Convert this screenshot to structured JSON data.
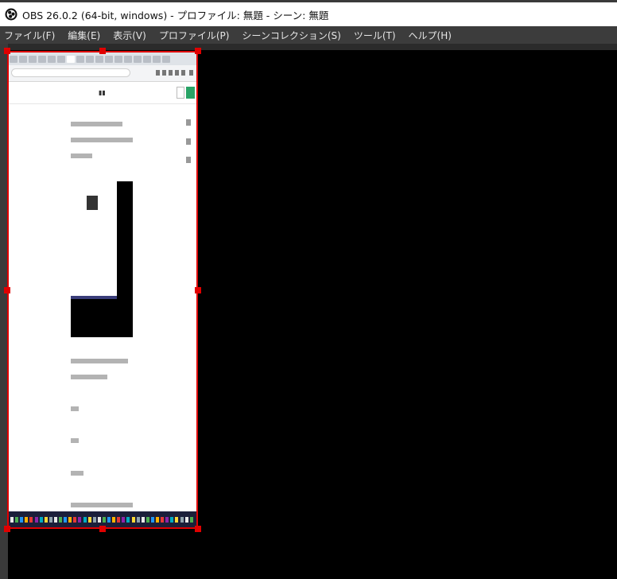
{
  "window": {
    "title": "OBS 26.0.2 (64-bit, windows) - プロファイル: 無題 - シーン: 無題"
  },
  "menu": {
    "items": [
      {
        "label": "ファイル(F)"
      },
      {
        "label": "編集(E)"
      },
      {
        "label": "表示(V)"
      },
      {
        "label": "プロファイル(P)"
      },
      {
        "label": "シーンコレクション(S)"
      },
      {
        "label": "ツール(T)"
      },
      {
        "label": "ヘルプ(H)"
      }
    ]
  },
  "preview": {
    "source_kind": "browser-window-capture",
    "selected": true,
    "selection_color": "#e00000",
    "canvas_color": "#000000"
  },
  "icons": {
    "app": "obs-logo-icon"
  }
}
